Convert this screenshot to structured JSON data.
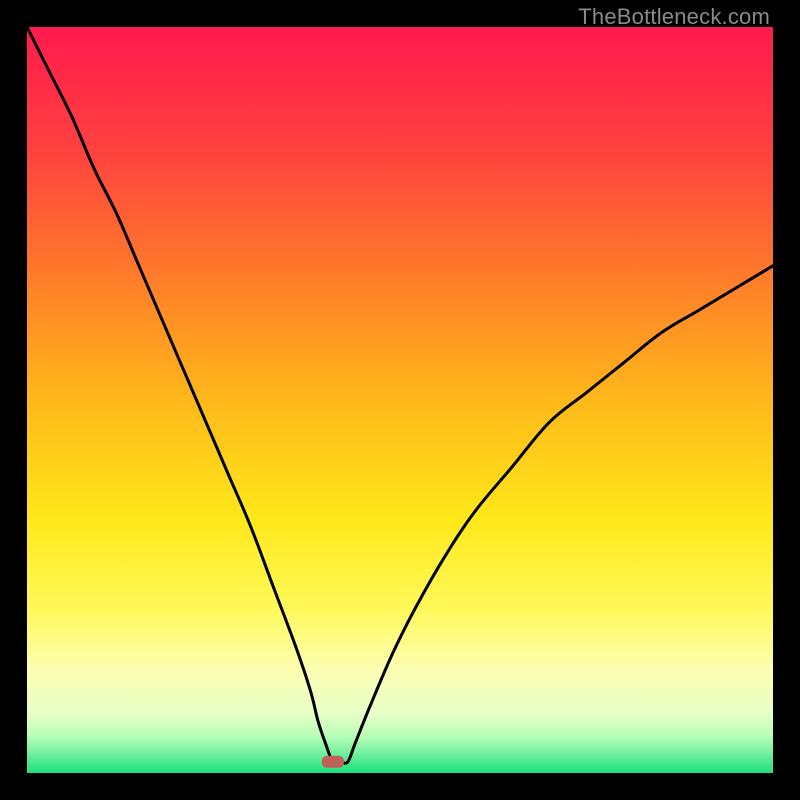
{
  "watermark": "TheBottleneck.com",
  "chart_data": {
    "type": "line",
    "title": "",
    "xlabel": "",
    "ylabel": "",
    "xlim": [
      0,
      100
    ],
    "ylim": [
      0,
      100
    ],
    "dip_x": 41,
    "marker": {
      "x": 41,
      "y": 1.5,
      "color": "#c06058"
    },
    "gradient_stops": [
      {
        "offset": 0.0,
        "color": "#ff1a4d"
      },
      {
        "offset": 0.16,
        "color": "#ff4040"
      },
      {
        "offset": 0.33,
        "color": "#ff7a2a"
      },
      {
        "offset": 0.5,
        "color": "#ffb81a"
      },
      {
        "offset": 0.66,
        "color": "#ffe81a"
      },
      {
        "offset": 0.78,
        "color": "#fff95a"
      },
      {
        "offset": 0.86,
        "color": "#fcffb0"
      },
      {
        "offset": 0.92,
        "color": "#e8ffc8"
      },
      {
        "offset": 0.95,
        "color": "#b8ffb8"
      },
      {
        "offset": 0.975,
        "color": "#6fef9f"
      },
      {
        "offset": 1.0,
        "color": "#18e07a"
      }
    ],
    "curve": {
      "x": [
        0,
        3,
        6,
        9,
        12,
        15,
        18,
        21,
        24,
        27,
        30,
        33,
        36,
        38,
        39,
        40,
        41,
        42,
        43,
        44,
        46,
        49,
        52,
        56,
        60,
        65,
        70,
        75,
        80,
        85,
        90,
        95,
        100
      ],
      "y": [
        100,
        94,
        88,
        81,
        75,
        68,
        61,
        54,
        47,
        40,
        33,
        25,
        17,
        11,
        7,
        4,
        1.5,
        1.5,
        1.5,
        4,
        9,
        16,
        22,
        29,
        35,
        41,
        47,
        51,
        55,
        59,
        62,
        65,
        68
      ]
    }
  }
}
